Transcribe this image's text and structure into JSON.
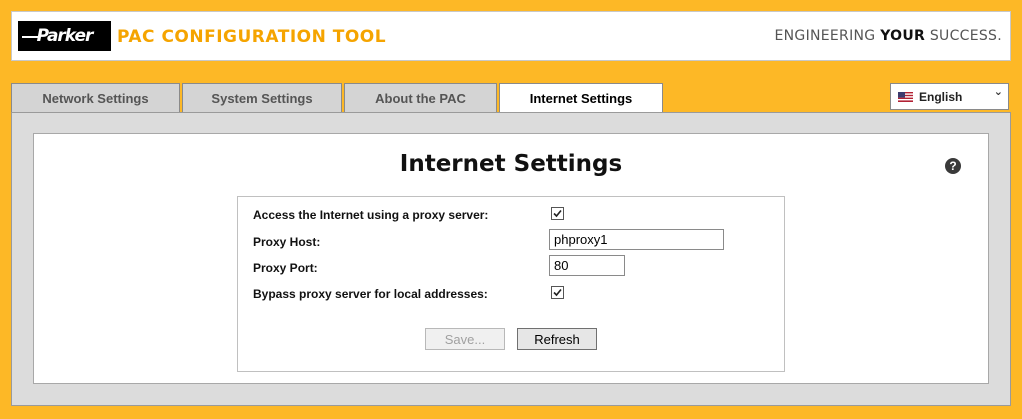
{
  "header": {
    "logo_text": "Parker",
    "app_title": "PAC CONFIGURATION TOOL",
    "tagline_pre": "ENGINEERING ",
    "tagline_bold": "YOUR",
    "tagline_post": " SUCCESS."
  },
  "tabs": [
    {
      "label": "Network Settings",
      "active": false
    },
    {
      "label": "System Settings",
      "active": false
    },
    {
      "label": "About the PAC",
      "active": false
    },
    {
      "label": "Internet Settings",
      "active": true
    }
  ],
  "language": {
    "selected": "English",
    "icon": "us-flag-icon"
  },
  "page": {
    "title": "Internet Settings",
    "help_glyph": "?"
  },
  "form": {
    "use_proxy_label": "Access the Internet using a proxy server:",
    "use_proxy_checked": true,
    "proxy_host_label": "Proxy Host:",
    "proxy_host_value": "phproxy1",
    "proxy_port_label": "Proxy Port:",
    "proxy_port_value": "80",
    "bypass_label": "Bypass proxy server for local addresses:",
    "bypass_checked": true
  },
  "buttons": {
    "save_label": "Save...",
    "save_enabled": false,
    "refresh_label": "Refresh"
  },
  "colors": {
    "background": "#fdb826",
    "title_accent": "#f5a400"
  }
}
